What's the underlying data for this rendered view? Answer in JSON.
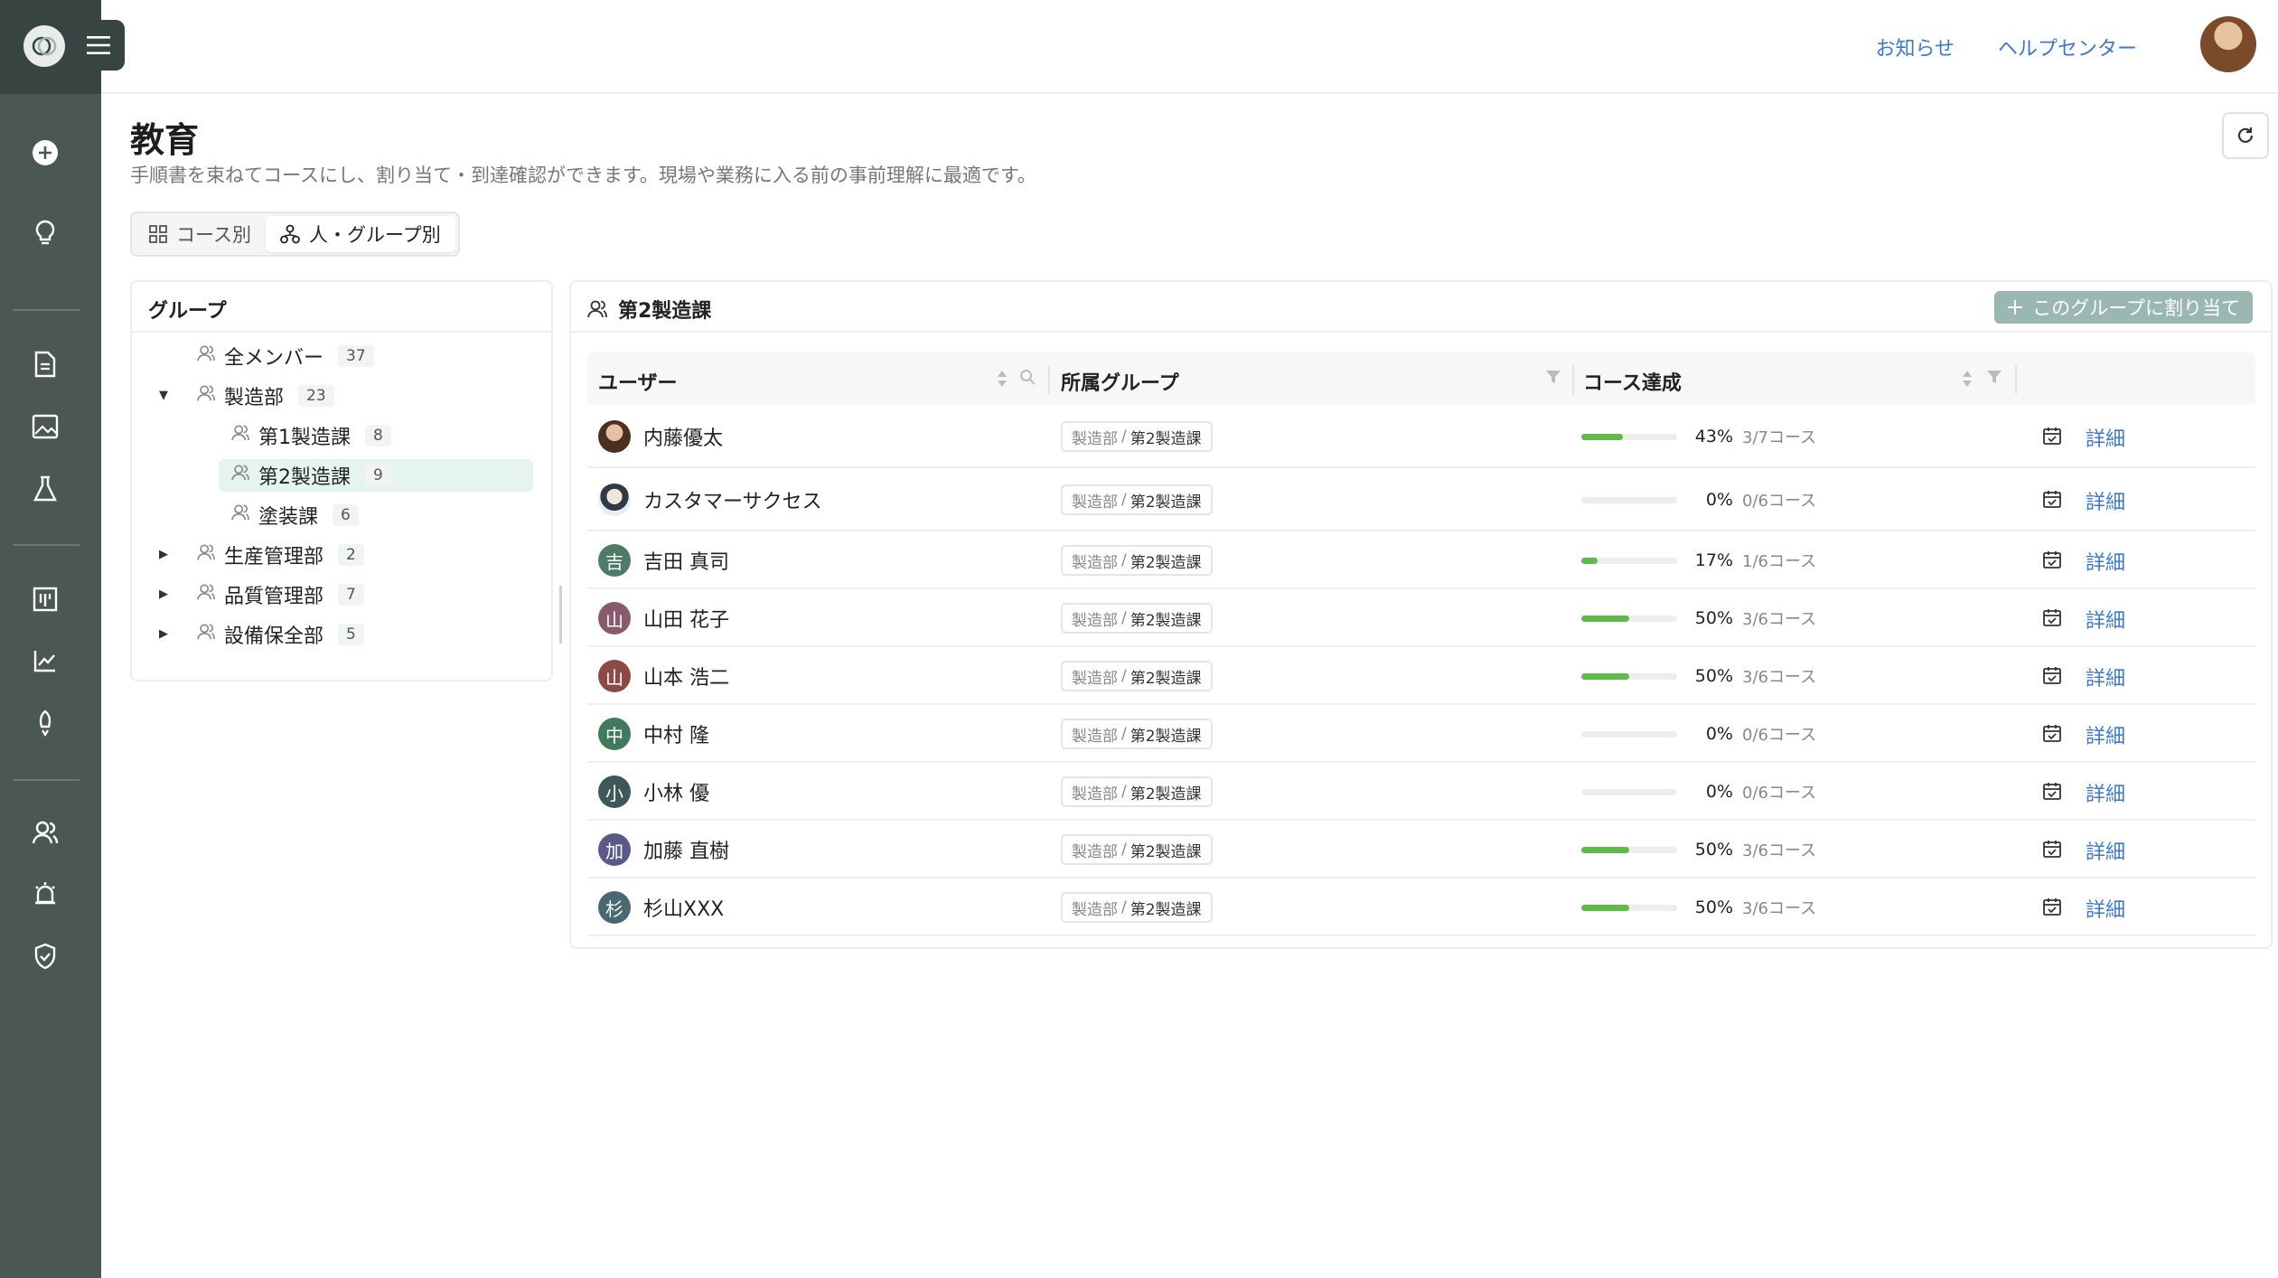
{
  "header": {
    "news_link": "お知らせ",
    "help_link": "ヘルプセンター"
  },
  "page": {
    "title": "教育",
    "description": "手順書を束ねてコースにし、割り当て・到達確認ができます。現場や業務に入る前の事前理解に最適です。"
  },
  "view_toggle": {
    "by_course": "コース別",
    "by_person": "人・グループ別"
  },
  "groups_panel": {
    "title": "グループ",
    "items": [
      {
        "label": "全メンバー",
        "count": "37"
      },
      {
        "label": "製造部",
        "count": "23"
      },
      {
        "label": "第1製造課",
        "count": "8"
      },
      {
        "label": "第2製造課",
        "count": "9"
      },
      {
        "label": "塗装課",
        "count": "6"
      },
      {
        "label": "生産管理部",
        "count": "2"
      },
      {
        "label": "品質管理部",
        "count": "7"
      },
      {
        "label": "設備保全部",
        "count": "5"
      }
    ]
  },
  "main_panel": {
    "title": "第2製造課",
    "assign_button": "このグループに割り当て",
    "columns": {
      "user": "ユーザー",
      "group": "所属グループ",
      "progress": "コース達成"
    },
    "rows": [
      {
        "name": "内藤優太",
        "avatar": "",
        "avatar_color": "#6b4a35",
        "parent": "製造部",
        "group": "第2製造課",
        "progress": 0.43,
        "pct": "43%",
        "courses": "3/7コース",
        "detail": "詳細"
      },
      {
        "name": "カスタマーサクセス",
        "avatar": "",
        "avatar_color": "#d6dde6",
        "parent": "製造部",
        "group": "第2製造課",
        "progress": 0,
        "pct": "0%",
        "courses": "0/6コース",
        "detail": "詳細"
      },
      {
        "name": "吉田 真司",
        "avatar": "吉",
        "avatar_color": "#4e7a68",
        "parent": "製造部",
        "group": "第2製造課",
        "progress": 0.17,
        "pct": "17%",
        "courses": "1/6コース",
        "detail": "詳細"
      },
      {
        "name": "山田 花子",
        "avatar": "山",
        "avatar_color": "#8a5a6c",
        "parent": "製造部",
        "group": "第2製造課",
        "progress": 0.5,
        "pct": "50%",
        "courses": "3/6コース",
        "detail": "詳細"
      },
      {
        "name": "山本 浩二",
        "avatar": "山",
        "avatar_color": "#8a4a48",
        "parent": "製造部",
        "group": "第2製造課",
        "progress": 0.5,
        "pct": "50%",
        "courses": "3/6コース",
        "detail": "詳細"
      },
      {
        "name": "中村 隆",
        "avatar": "中",
        "avatar_color": "#3f7a5e",
        "parent": "製造部",
        "group": "第2製造課",
        "progress": 0,
        "pct": "0%",
        "courses": "0/6コース",
        "detail": "詳細"
      },
      {
        "name": "小林 優",
        "avatar": "小",
        "avatar_color": "#3f5756",
        "parent": "製造部",
        "group": "第2製造課",
        "progress": 0,
        "pct": "0%",
        "courses": "0/6コース",
        "detail": "詳細"
      },
      {
        "name": "加藤 直樹",
        "avatar": "加",
        "avatar_color": "#5a5a8a",
        "parent": "製造部",
        "group": "第2製造課",
        "progress": 0.5,
        "pct": "50%",
        "courses": "3/6コース",
        "detail": "詳細"
      },
      {
        "name": "杉山XXX",
        "avatar": "杉",
        "avatar_color": "#4a6870",
        "parent": "製造部",
        "group": "第2製造課",
        "progress": 0.5,
        "pct": "50%",
        "courses": "3/6コース",
        "detail": "詳細"
      }
    ]
  },
  "colors": {
    "sidebar": "#4a5755",
    "accent_link": "#3d78c9",
    "progress_fill": "#5cbb4b",
    "selected_group": "#e5f4ef",
    "assign_button": "#9ab8b1"
  }
}
